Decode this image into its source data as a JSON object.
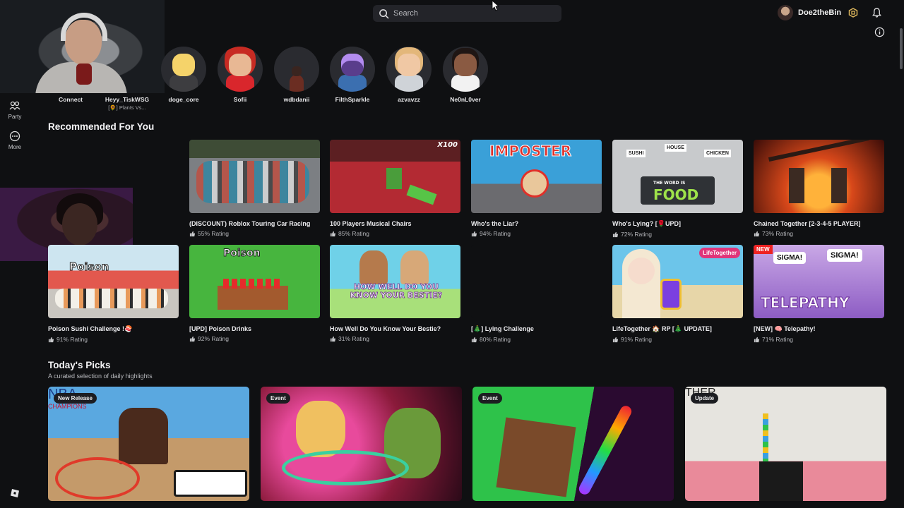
{
  "search": {
    "placeholder": "Search"
  },
  "user": {
    "name": "Doe2theBin"
  },
  "sidebar": {
    "party_label": "Party",
    "more_label": "More"
  },
  "friends": {
    "connect_label": "Connect",
    "items": [
      {
        "name": "Heyy_TiskWSG",
        "status": "[🌻] Plants Vs..."
      },
      {
        "name": "doge_core"
      },
      {
        "name": "Sofii"
      },
      {
        "name": "wdbdanii"
      },
      {
        "name": "FilthSparkle"
      },
      {
        "name": "azvavzz"
      },
      {
        "name": "Ne0nL0ver"
      }
    ]
  },
  "recommended": {
    "title": "Recommended For You",
    "games": [
      {
        "title": "(DISCOUNT) Roblox Touring Car Racing",
        "rating": "55% Rating"
      },
      {
        "title": "100 Players Musical Chairs",
        "rating": "85% Rating",
        "thumb_text": "X100"
      },
      {
        "title": "Who's the Liar?",
        "rating": "94% Rating",
        "thumb_text": "IMPOSTER"
      },
      {
        "title": "Who's Lying? [🌹UPD]",
        "rating": "72% Rating",
        "thumb_text": "FOOD",
        "thumb_sub": "THE WORD IS",
        "words": [
          "SUSHI",
          "HOUSE",
          "CHICKEN"
        ]
      },
      {
        "title": "Chained Together [2-3-4-5 PLAYER]",
        "rating": "73% Rating"
      },
      {
        "title": "Poison Sushi Challenge !🍣",
        "rating": "91% Rating",
        "thumb_text": "Poison"
      },
      {
        "title": "[UPD] Poison Drinks",
        "rating": "92% Rating",
        "thumb_text": "Poison"
      },
      {
        "title": "How Well Do You Know Your Bestie?",
        "rating": "31% Rating",
        "thumb_text": "HOW WELL DO YOU KNOW YOUR BESTIE?"
      },
      {
        "title": "[🎄] Lying Challenge",
        "rating": "80% Rating"
      },
      {
        "title": "LifeTogether 🏠 RP [🎄 UPDATE]",
        "rating": "91% Rating",
        "thumb_tag": "LifeTogether"
      },
      {
        "title": "[NEW] 🧠 Telepathy!",
        "rating": "71% Rating",
        "thumb_tag": "NEW",
        "thumb_text": "TELEPATHY",
        "bubble1": "SIGMA!",
        "bubble2": "SIGMA!"
      }
    ]
  },
  "picks": {
    "title": "Today's Picks",
    "description": "A curated selection of daily highlights",
    "items": [
      {
        "badge": "New Release",
        "thumb_text": "NBA",
        "thumb_sub": "CHAMPIONS"
      },
      {
        "badge": "Event"
      },
      {
        "badge": "Event"
      },
      {
        "badge": "Update",
        "thumb_text": "THER"
      }
    ]
  },
  "colors": {
    "background": "#0f1012",
    "search_bg": "#232429",
    "text_primary": "#f4f4f6",
    "text_muted": "#b5b6ba"
  }
}
